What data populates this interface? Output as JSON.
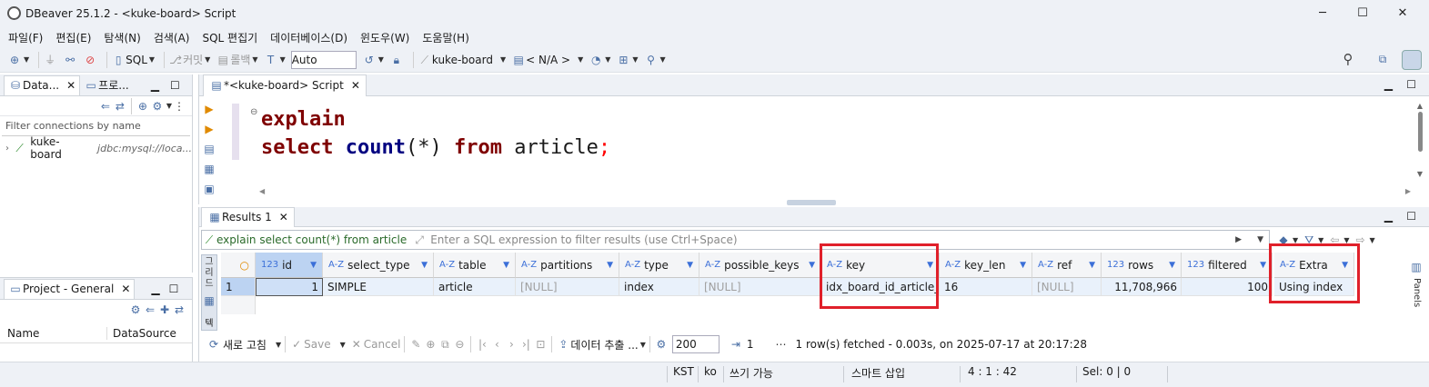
{
  "window": {
    "title": "DBeaver 25.1.2 - <kuke-board> Script",
    "minimize": "─",
    "maximize": "☐",
    "close": "✕"
  },
  "menu": [
    "파일(F)",
    "편집(E)",
    "탐색(N)",
    "검색(A)",
    "SQL 편집기",
    "데이터베이스(D)",
    "윈도우(W)",
    "도움말(H)"
  ],
  "toolbar": {
    "sql": "SQL",
    "commit": "커밋",
    "rollback": "롤백",
    "mode": "Auto",
    "datasource": "kuke-board",
    "schema": "< N/A >"
  },
  "nav_panel": {
    "tab1": "Data...",
    "tab2": "프로...",
    "filter_placeholder": "Filter connections by name",
    "conn_name": "kuke-board",
    "conn_url": "jdbc:mysql://loca..."
  },
  "project_panel": {
    "title": "Project - General",
    "col_name": "Name",
    "col_ds": "DataSource"
  },
  "editor": {
    "tab": "*<kuke-board> Script",
    "line1_kw": "explain",
    "line2_kw1": "select",
    "line2_fn": "count",
    "line2_args": "(*)",
    "line2_kw2": "from",
    "line2_tbl": "article",
    "line2_end": ";"
  },
  "results": {
    "tab": "Results 1",
    "query": "explain select count(*) from article",
    "filter_placeholder": "Enter a SQL expression to filter results (use Ctrl+Space)",
    "side_label_1": "그리드",
    "side_label_2": "텍",
    "row_number": "1",
    "columns": [
      {
        "type": "123",
        "name": "id"
      },
      {
        "type": "A-Z",
        "name": "select_type"
      },
      {
        "type": "A-Z",
        "name": "table"
      },
      {
        "type": "A-Z",
        "name": "partitions"
      },
      {
        "type": "A-Z",
        "name": "type"
      },
      {
        "type": "A-Z",
        "name": "possible_keys"
      },
      {
        "type": "A-Z",
        "name": "key"
      },
      {
        "type": "A-Z",
        "name": "key_len"
      },
      {
        "type": "A-Z",
        "name": "ref"
      },
      {
        "type": "123",
        "name": "rows"
      },
      {
        "type": "123",
        "name": "filtered"
      },
      {
        "type": "A-Z",
        "name": "Extra"
      }
    ],
    "row": [
      "1",
      "SIMPLE",
      "article",
      "[NULL]",
      "index",
      "[NULL]",
      "idx_board_id_article_id",
      "16",
      "[NULL]",
      "11,708,966",
      "100",
      "Using index"
    ],
    "panels_label": "Panels",
    "bottom": {
      "refresh": "새로 고침",
      "save": "Save",
      "cancel": "Cancel",
      "export": "데이터 추출 ...",
      "fetch_size": "200",
      "page": "1",
      "status": "1 row(s) fetched - 0.003s, on 2025-07-17 at 20:17:28"
    }
  },
  "statusbar": {
    "tz": "KST",
    "lang": "ko",
    "write": "쓰기 가능",
    "insert": "스마트 삽입",
    "pos": "4 : 1 : 42",
    "sel": "Sel: 0 | 0"
  },
  "colors": {
    "highlight": "#e0202a",
    "keyword": "#7f0000",
    "function": "#000080"
  }
}
